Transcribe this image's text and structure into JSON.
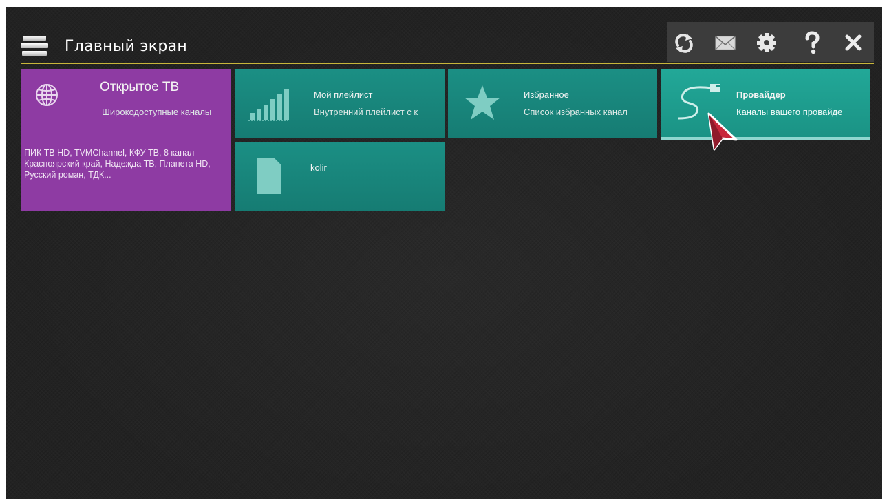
{
  "header": {
    "title": "Главный экран",
    "menu_icon": "hamburger-menu-icon",
    "toolbar": [
      {
        "name": "refresh-icon",
        "glyph": "refresh"
      },
      {
        "name": "mail-icon",
        "glyph": "envelope"
      },
      {
        "name": "settings-icon",
        "glyph": "gear"
      },
      {
        "name": "help-icon",
        "glyph": "question"
      },
      {
        "name": "close-icon",
        "glyph": "close"
      }
    ]
  },
  "tiles": [
    {
      "title": "Открытое ТВ",
      "subtitle": "Широкодоступные каналы",
      "description": "ПИК ТВ HD, TVMChannel, КФУ ТВ, 8 канал Красноярский край, Надежда ТВ, Планета HD, Русский роман, ТДК...",
      "icon": "globe-icon",
      "color": "#8e3ba3"
    },
    {
      "title": "Мой плейлист",
      "subtitle": "Внутренний плейлист с к",
      "icon": "signal-bars-icon",
      "color": "#1b8f84"
    },
    {
      "title": "Избранное",
      "subtitle": "Список избранных канал",
      "icon": "star-icon",
      "color": "#1b8f84"
    },
    {
      "title": "Провайдер",
      "subtitle": "Каналы вашего провайде",
      "icon": "cable-plug-icon",
      "color": "#22a898",
      "selected": true
    },
    {
      "title": "kolir",
      "subtitle": "",
      "icon": "document-icon",
      "color": "#1b8f84"
    }
  ],
  "colors": {
    "background": "#222222",
    "accent_line": "#c8b63a",
    "purple": "#8e3ba3",
    "teal": "#1b8f84",
    "selection": "#8ed7cf",
    "cursor": "#c8283c"
  }
}
